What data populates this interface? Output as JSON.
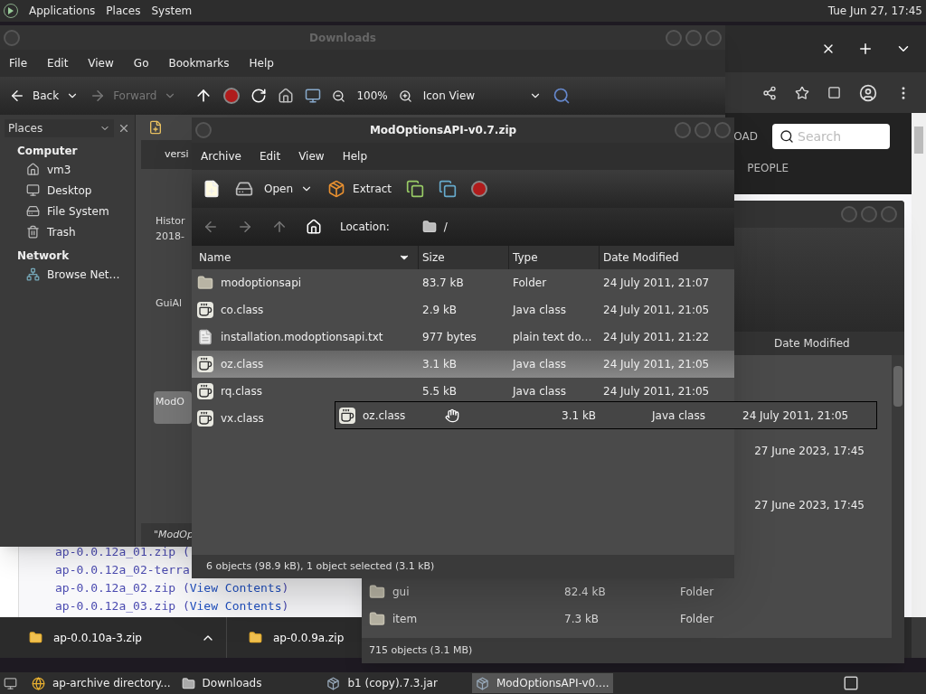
{
  "top_panel": {
    "menus": [
      "Applications",
      "Places",
      "System"
    ],
    "clock": "Tue Jun 27, 17:45"
  },
  "browser": {
    "page_links": [
      "OAD",
      "PEOPLE"
    ],
    "search": {
      "placeholder": "Search"
    },
    "listing": [
      {
        "file": "ap-0.0.12a_01.zip ("
      },
      {
        "file": "ap-0.0.12a_02-terra"
      },
      {
        "file": "ap-0.0.12a_02.zip (",
        "link": "View Contents",
        "tail": ")"
      },
      {
        "file": "ap-0.0.12a_03.zip (",
        "link": "View Contents",
        "tail": ")"
      }
    ],
    "downloads": [
      "ap-0.0.10a-3.zip",
      "ap-0.0.9a.zip"
    ]
  },
  "file_manager": {
    "title": "Downloads",
    "menu": [
      "File",
      "Edit",
      "View",
      "Go",
      "Bookmarks",
      "Help"
    ],
    "toolbar": [
      {
        "kind": "back",
        "label": "Back",
        "disabled": false
      },
      {
        "kind": "forward",
        "label": "Forward",
        "disabled": true
      }
    ],
    "zoom": "100%",
    "view": "Icon View",
    "sidebar": {
      "title": "Places",
      "sections": [
        {
          "heading": "Computer",
          "items": [
            {
              "kind": "home",
              "label": "vm3"
            },
            {
              "kind": "desktop",
              "label": "Desktop"
            },
            {
              "kind": "drive",
              "label": "File System"
            },
            {
              "kind": "trash",
              "label": "Trash"
            }
          ]
        },
        {
          "heading": "Network",
          "items": [
            {
              "kind": "network",
              "label": "Browse Net…"
            }
          ]
        }
      ]
    },
    "tab": "versi",
    "fragments": [
      "Histor",
      "2018-",
      "GuiAl"
    ],
    "selected_item": "ModO",
    "status": "\"ModOp"
  },
  "back_archive": {
    "columns": [
      "Date Modified"
    ],
    "dates": [
      "27 June 2023, 17:45",
      "27 June 2023, 17:45"
    ],
    "rows": [
      {
        "name": "gui",
        "size": "82.4 kB",
        "type": "Folder"
      },
      {
        "name": "item",
        "size": "7.3 kB",
        "type": "Folder"
      }
    ],
    "status": "715 objects (3.1 MB)"
  },
  "archive": {
    "title": "ModOptionsAPI-v0.7.zip",
    "menu": [
      "Archive",
      "Edit",
      "View",
      "Help"
    ],
    "open": "Open",
    "extract": "Extract",
    "location_label": "Location:",
    "location": "/",
    "columns": [
      "Name",
      "Size",
      "Type",
      "Date Modified"
    ],
    "rows": [
      {
        "kind": "folder",
        "name": "modoptionsapi",
        "size": "83.7 kB",
        "type": "Folder",
        "date": "24 July 2011, 21:07",
        "selected": false
      },
      {
        "kind": "java",
        "name": "co.class",
        "size": "2.9 kB",
        "type": "Java class",
        "date": "24 July 2011, 21:05",
        "selected": false
      },
      {
        "kind": "text",
        "name": "installation.modoptionsapi.txt",
        "size": "977 bytes",
        "type": "plain text do…",
        "date": "24 July 2011, 21:22",
        "selected": false
      },
      {
        "kind": "java",
        "name": "oz.class",
        "size": "3.1 kB",
        "type": "Java class",
        "date": "24 July 2011, 21:05",
        "selected": true
      },
      {
        "kind": "java",
        "name": "rq.class",
        "size": "5.5 kB",
        "type": "Java class",
        "date": "24 July 2011, 21:05",
        "selected": false
      },
      {
        "kind": "java",
        "name": "vx.class",
        "selected": false
      }
    ],
    "status": "6 objects (98.9 kB), 1 object selected (3.1 kB)"
  },
  "drag_row": {
    "name": "oz.class",
    "size": "3.1 kB",
    "type": "Java class",
    "date": "24 July 2011, 21:05"
  },
  "taskbar": [
    {
      "kind": "browser",
      "label": "ap-archive directory...",
      "selected": false
    },
    {
      "kind": "folder",
      "label": "Downloads",
      "selected": false
    },
    {
      "kind": "archive",
      "label": "b1 (copy).7.3.jar",
      "selected": false
    },
    {
      "kind": "archive",
      "label": "ModOptionsAPI-v0....",
      "selected": true
    }
  ]
}
